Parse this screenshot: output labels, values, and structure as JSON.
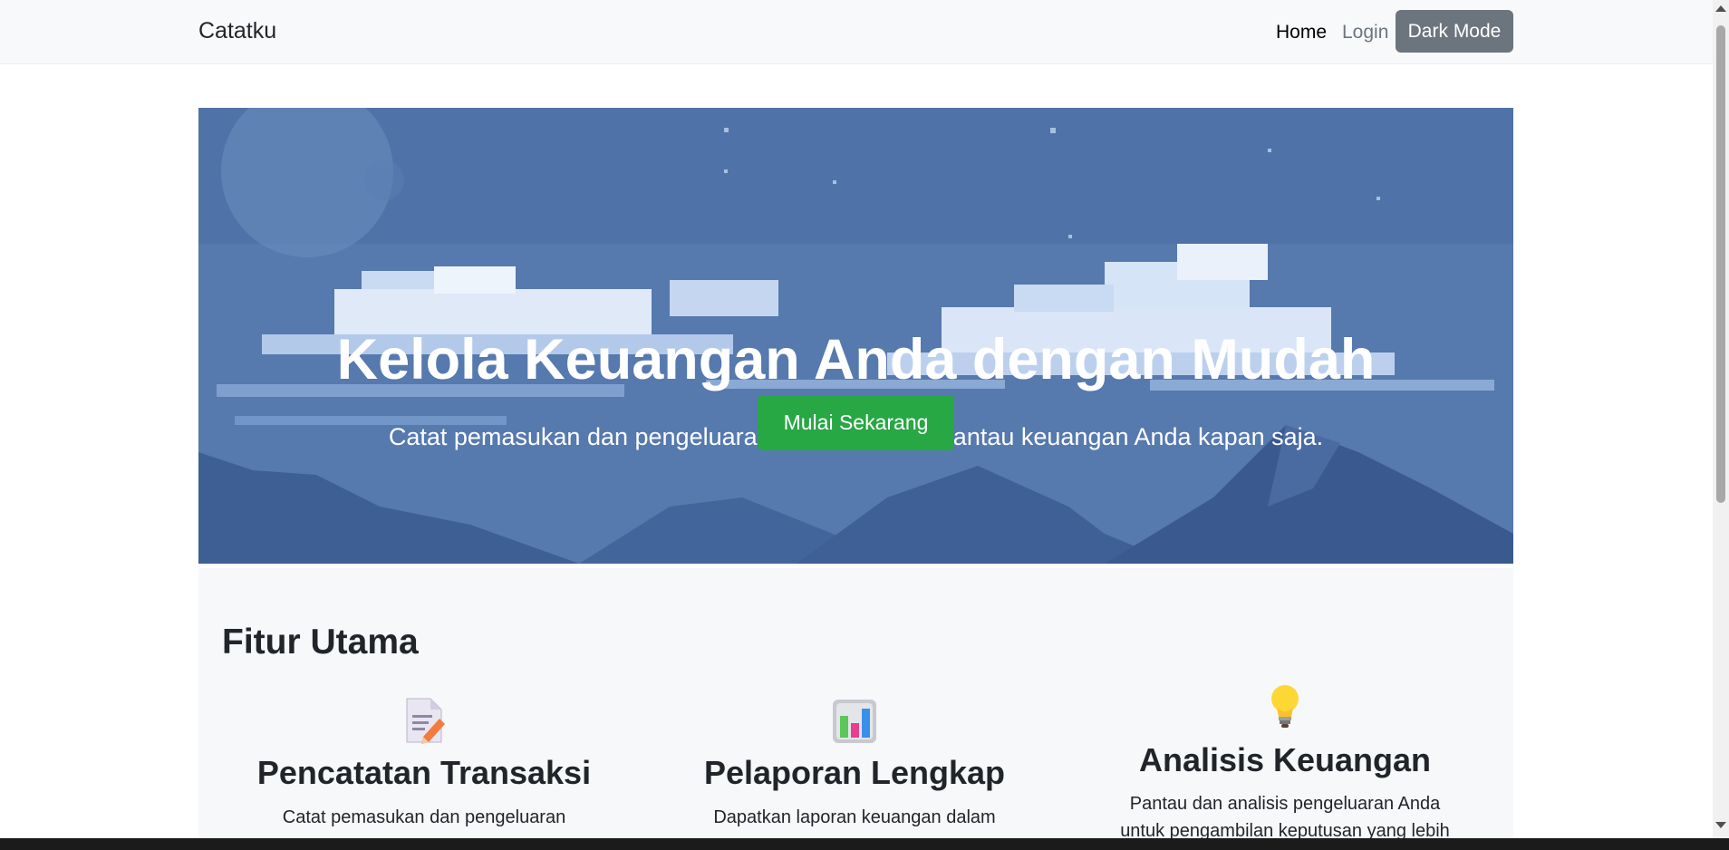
{
  "navbar": {
    "brand": "Catatku",
    "home": "Home",
    "login": "Login",
    "dark_mode": "Dark Mode"
  },
  "hero": {
    "title": "Kelola Keuangan Anda dengan Mudah",
    "subtitle": "Catat pemasukan dan pengeluaran dengan cepat, pantau keuangan Anda kapan saja.",
    "cta": "Mulai Sekarang"
  },
  "features": {
    "title": "Fitur Utama",
    "items": [
      {
        "icon": "memo-icon",
        "title": "Pencatatan Transaksi",
        "desc": "Catat pemasukan dan pengeluaran"
      },
      {
        "icon": "bar-chart-icon",
        "title": "Pelaporan Lengkap",
        "desc": "Dapatkan laporan keuangan dalam"
      },
      {
        "icon": "light-bulb-icon",
        "title": "Analisis Keuangan",
        "desc1": "Pantau dan analisis pengeluaran Anda",
        "desc2": "untuk pengambilan keputusan yang lebih"
      }
    ]
  },
  "colors": {
    "navbar_bg": "#f8f9fa",
    "dark_button": "#6c757d",
    "cta_green": "#28a745",
    "hero_sky": "#4f72a8",
    "features_bg": "#f7f8fa"
  }
}
